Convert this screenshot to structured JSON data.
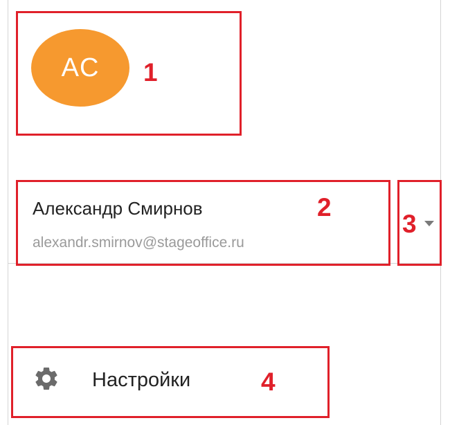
{
  "profile": {
    "avatar_initials": "AC",
    "avatar_color": "#f6992f",
    "name": "Александр Смирнов",
    "email": "alexandr.smirnov@stageoffice.ru",
    "account_menu_icon": "chevron-down-icon"
  },
  "menu": {
    "settings_label": "Настройки",
    "settings_icon": "gear-icon"
  },
  "callouts": {
    "color": "#e0202a",
    "labels": [
      "1",
      "2",
      "3",
      "4"
    ]
  }
}
